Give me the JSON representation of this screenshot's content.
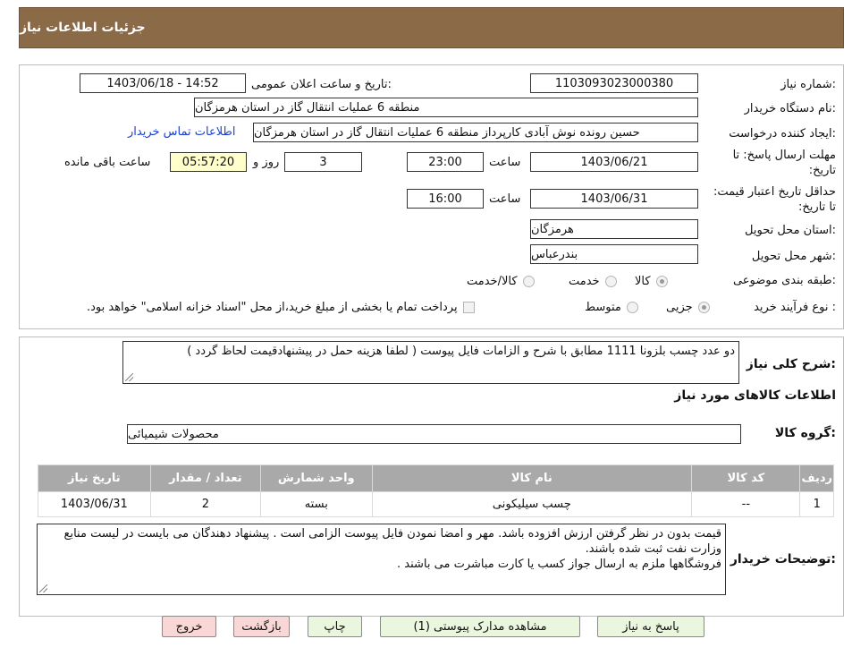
{
  "header": {
    "title": "جزئیات اطلاعات نیاز"
  },
  "form": {
    "need_number_label": "شماره نیاز:",
    "need_number": "1103093023000380",
    "announce_label": "تاریخ و ساعت اعلان عمومی:",
    "announce_value": "1403/06/18 - 14:52",
    "buyer_org_label": "نام دستگاه خریدار:",
    "buyer_org": "منطقه 6 عملیات انتقال گاز در استان هرمزگان",
    "creator_label": "ایجاد کننده درخواست:",
    "creator": "حسین رونده نوش آبادی کارپرداز منطقه 6 عملیات انتقال گاز در استان هرمزگان",
    "contact_link": "اطلاعات تماس خریدار",
    "deadline_label": "مهلت ارسال پاسخ: تا تاریخ:",
    "deadline_date": "1403/06/21",
    "time_word": "ساعت",
    "deadline_time": "23:00",
    "days_value": "3",
    "days_word": "روز و",
    "remaining_time": "05:57:20",
    "remaining_word": "ساعت باقی مانده",
    "validity_label": "حداقل تاریخ اعتبار قیمت: تا تاریخ:",
    "validity_date": "1403/06/31",
    "validity_time": "16:00",
    "province_label": "استان محل تحویل:",
    "province": "هرمزگان",
    "city_label": "شهر محل تحویل:",
    "city": "بندرعباس",
    "category_label": "طبقه بندی موضوعی:",
    "category_options": [
      "کالا",
      "خدمت",
      "کالا/خدمت"
    ],
    "category_selected": "کالا",
    "process_label": "نوع فرآیند خرید :",
    "process_options": [
      "جزیی",
      "متوسط"
    ],
    "process_selected": "جزیی",
    "payment_note": "پرداخت تمام یا بخشی از مبلغ خرید،از محل \"اسناد خزانه اسلامی\" خواهد بود."
  },
  "summary": {
    "label": "شرح کلی نیاز:",
    "text": "دو عدد چسب بلزونا 1111 مطابق با شرح و الزامات فایل پیوست ( لطفا هزینه حمل در پیشنهادقیمت لحاظ گردد )",
    "goods_info_title": "اطلاعات کالاهای مورد نیاز",
    "goods_group_label": "گروه کالا:",
    "goods_group": "محصولات شیمیائی"
  },
  "table": {
    "headers": [
      "ردیف",
      "کد کالا",
      "نام کالا",
      "واحد شمارش",
      "تعداد / مقدار",
      "تاریخ نیاز"
    ],
    "rows": [
      [
        "1",
        "--",
        "چسب سیلیکونی",
        "بسته",
        "2",
        "1403/06/31"
      ]
    ]
  },
  "notes": {
    "label": "توضیحات خریدار:",
    "lines": [
      "قیمت بدون در نظر گرفتن  ارزش افزوده باشد. مهر و امضا نمودن فایل پیوست الزامی است . پیشنهاد دهندگان می بایست در لیست منابع وزارت نفت ثبت شده  باشند.",
      "فروشگاهها ملزم به ارسال جواز کسب یا کارت مباشرت می باشند ."
    ]
  },
  "buttons": {
    "respond": "پاسخ به نیاز",
    "attachments": "مشاهده مدارک پیوستی (1)",
    "print": "چاپ",
    "back": "بازگشت",
    "exit": "خروج"
  },
  "colors": {
    "header_bg": "#8b6a47",
    "table_header_bg": "#a9a9a9",
    "green_button": "#eaf6dd",
    "pink_button": "#f9d7d7",
    "timer_bg": "#ffffcc",
    "link": "#1a3fd4"
  }
}
